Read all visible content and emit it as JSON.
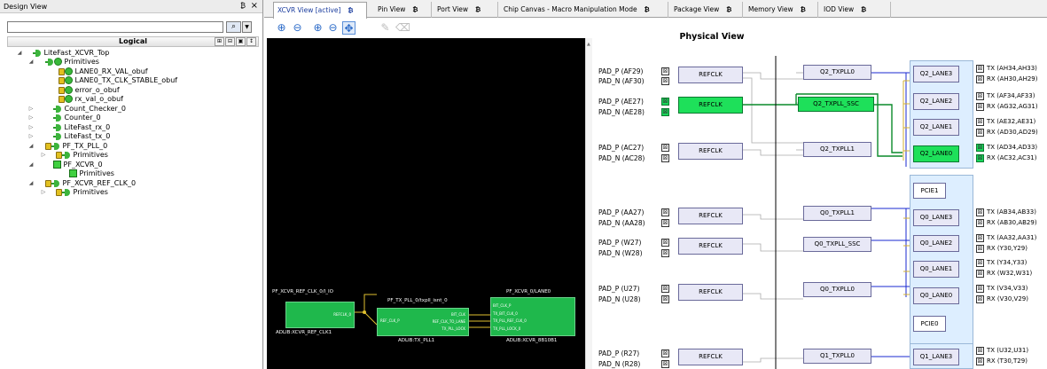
{
  "design_view": {
    "title": "Design View",
    "pin_glyph": "₿",
    "close_glyph": "×",
    "search_value": "",
    "header_label": "Logical",
    "tree": [
      {
        "label": "LiteFast_XCVR_Top",
        "icon": "design",
        "expander": "◢"
      },
      {
        "label": "Primitives",
        "icon": "primitive",
        "expander": "◢"
      },
      {
        "label": "LANE0_RX_VAL_obuf",
        "icon": "primitive-locked"
      },
      {
        "label": "LANE0_TX_CLK_STABLE_obuf",
        "icon": "primitive-locked"
      },
      {
        "label": "error_o_obuf",
        "icon": "primitive-locked"
      },
      {
        "label": "rx_val_o_obuf",
        "icon": "primitive-locked"
      },
      {
        "label": "Count_Checker_0",
        "icon": "design",
        "expander": "▷"
      },
      {
        "label": "Counter_0",
        "icon": "design",
        "expander": "▷"
      },
      {
        "label": "LiteFast_rx_0",
        "icon": "design",
        "expander": "▷"
      },
      {
        "label": "LiteFast_tx_0",
        "icon": "design",
        "expander": "▷"
      },
      {
        "label": "PF_TX_PLL_0",
        "icon": "design-locked",
        "expander": "◢"
      },
      {
        "label": "Primitives",
        "icon": "design-locked",
        "expander": "▷"
      },
      {
        "label": "PF_XCVR_0",
        "icon": "xcvr",
        "expander": "◢"
      },
      {
        "label": "Primitives",
        "icon": "xcvr"
      },
      {
        "label": "PF_XCVR_REF_CLK_0",
        "icon": "design-locked",
        "expander": "◢"
      },
      {
        "label": "Primitives",
        "icon": "design-locked",
        "expander": "▷"
      }
    ]
  },
  "tabs": [
    {
      "label": "XCVR View [active]",
      "active": true
    },
    {
      "label": "Pin View"
    },
    {
      "label": "Port View"
    },
    {
      "label": "Chip Canvas - Macro Manipulation Mode"
    },
    {
      "label": "Package View"
    },
    {
      "label": "Memory View"
    },
    {
      "label": "IOD View"
    }
  ],
  "tab_pin_glyph": "₿",
  "toolbar": [
    "zoom-fit-icon",
    "zoom-out-icon",
    "zoom-in-icon",
    "zoom-out-alt-icon",
    "move-icon",
    "pencil-icon",
    "eraser-icon"
  ],
  "canvas": {
    "refclk_title": "PF_XCVR_REF_CLK_0/I_IO",
    "refclk_port": "REFCLK_0",
    "refclk_footer": "ADLIB:XCVR_REF_CLK1",
    "txpll_title": "PF_TX_PLL_0/txpll_isnt_0",
    "txpll_in": "REF_CLK_P",
    "txpll_out1": "BIT_CLK",
    "txpll_out2": "REF_CLK_TO_LANE",
    "txpll_out3": "TX_PLL_LOCK",
    "txpll_footer": "ADLIB:TX_PLL1",
    "lane_title": "PF_XCVR_0/LANE0",
    "lane_port1": "BIT_CLK_P",
    "lane_port2": "TX_BIT_CLK_0",
    "lane_port3": "TX_PLL_REF_CLK_0",
    "lane_port4": "TX_PLL_LOCK_0",
    "lane_footer": "ADLIB:XCVR_8B10B1"
  },
  "physical": {
    "title": "Physical View",
    "refclks": [
      {
        "p": "PAD_P (AF29)",
        "n": "PAD_N (AF30)",
        "label": "REFCLK",
        "highlight": false
      },
      {
        "p": "PAD_P (AE27)",
        "n": "PAD_N (AE28)",
        "label": "REFCLK",
        "highlight": true
      },
      {
        "p": "PAD_P (AC27)",
        "n": "PAD_N (AC28)",
        "label": "REFCLK",
        "highlight": false
      },
      {
        "p": "PAD_P (AA27)",
        "n": "PAD_N (AA28)",
        "label": "REFCLK",
        "highlight": false
      },
      {
        "p": "PAD_P (W27)",
        "n": "PAD_N (W28)",
        "label": "REFCLK",
        "highlight": false
      },
      {
        "p": "PAD_P (U27)",
        "n": "PAD_N (U28)",
        "label": "REFCLK",
        "highlight": false
      },
      {
        "p": "PAD_P (R27)",
        "n": "PAD_N (R28)",
        "label": "REFCLK",
        "highlight": false
      }
    ],
    "plls": [
      {
        "label": "Q2_TXPLL0",
        "highlight": false
      },
      {
        "label": "Q2_TXPLL_SSC",
        "highlight": true
      },
      {
        "label": "Q2_TXPLL1",
        "highlight": false
      },
      {
        "label": "Q0_TXPLL1",
        "highlight": false
      },
      {
        "label": "Q0_TXPLL_SSC",
        "highlight": false
      },
      {
        "label": "Q0_TXPLL0",
        "highlight": false
      },
      {
        "label": "Q1_TXPLL0",
        "highlight": false
      }
    ],
    "lanes": [
      {
        "label": "Q2_LANE3",
        "tx": "TX (AH34,AH33)",
        "rx": "RX (AH30,AH29)",
        "highlight": false
      },
      {
        "label": "Q2_LANE2",
        "tx": "TX (AF34,AF33)",
        "rx": "RX (AG32,AG31)",
        "highlight": false
      },
      {
        "label": "Q2_LANE1",
        "tx": "TX (AE32,AE31)",
        "rx": "RX (AD30,AD29)",
        "highlight": false
      },
      {
        "label": "Q2_LANE0",
        "tx": "TX (AD34,AD33)",
        "rx": "RX (AC32,AC31)",
        "highlight": true
      },
      {
        "label": "Q0_LANE3",
        "tx": "TX (AB34,AB33)",
        "rx": "RX (AB30,AB29)",
        "highlight": false
      },
      {
        "label": "Q0_LANE2",
        "tx": "TX (AA32,AA31)",
        "rx": "RX (Y30,Y29)",
        "highlight": false
      },
      {
        "label": "Q0_LANE1",
        "tx": "TX (Y34,Y33)",
        "rx": "RX (W32,W31)",
        "highlight": false
      },
      {
        "label": "Q0_LANE0",
        "tx": "TX (V34,V33)",
        "rx": "RX (V30,V29)",
        "highlight": false
      },
      {
        "label": "Q1_LANE3",
        "tx": "TX (U32,U31)",
        "rx": "RX (T30,T29)",
        "highlight": false
      }
    ],
    "pcie": [
      "PCIE1",
      "PCIE0"
    ]
  },
  "colors": {
    "accent_green": "#1ee05a",
    "wire_blue": "#1a2ad0",
    "wire_green": "#0a8a2a",
    "wire_gold": "#d8b020",
    "macro_green": "#1fb84c"
  }
}
